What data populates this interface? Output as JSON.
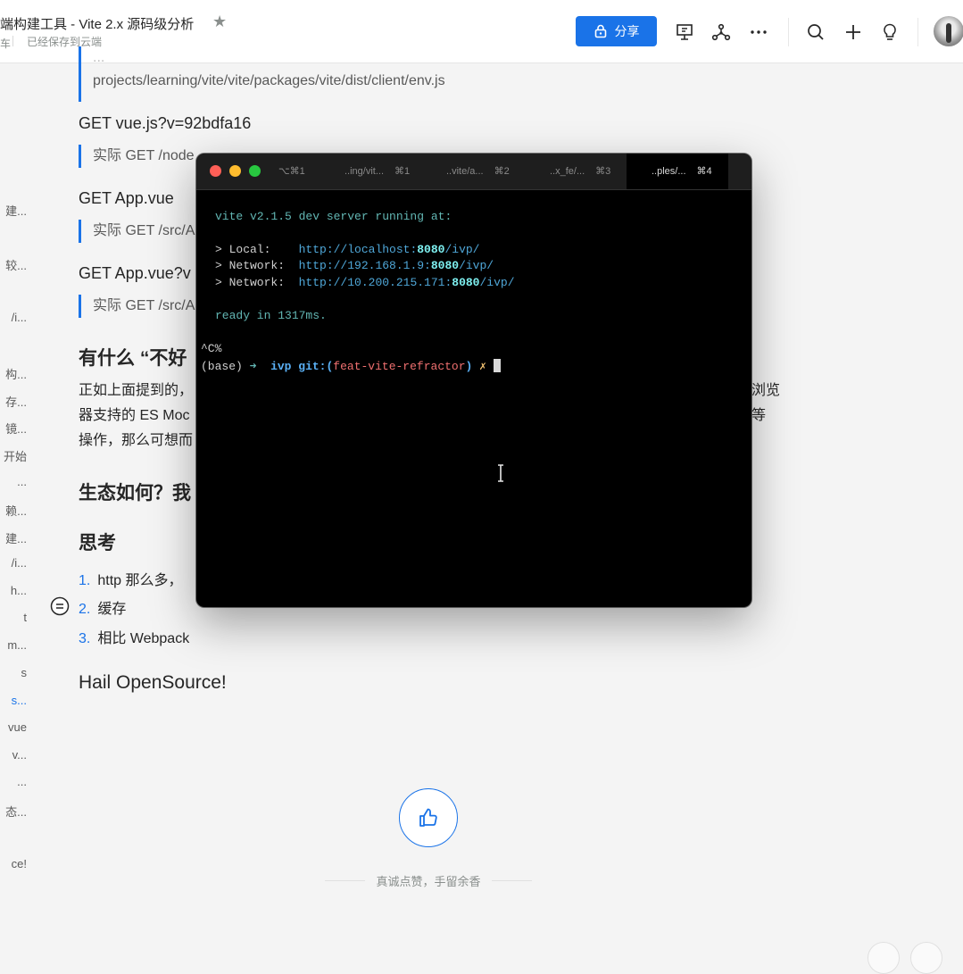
{
  "header": {
    "doc_title": "端构建工具 - Vite 2.x 源码级分析",
    "sub_prefix": "车",
    "save_status": "已经保存到云端",
    "share_label": "分享"
  },
  "sidebar": {
    "items": [
      {
        "label": "建..."
      },
      {
        "label": "较..."
      },
      {
        "label": "/i..."
      },
      {
        "label": "构..."
      },
      {
        "label": "存..."
      },
      {
        "label": "镜..."
      },
      {
        "label": "开始"
      },
      {
        "label": "..."
      },
      {
        "label": "赖..."
      },
      {
        "label": "建..."
      },
      {
        "label": "/i..."
      },
      {
        "label": "h..."
      },
      {
        "label": "t"
      },
      {
        "label": "m..."
      },
      {
        "label": "s"
      },
      {
        "label": "s...",
        "active": true
      },
      {
        "label": "vue"
      },
      {
        "label": "v..."
      },
      {
        "label": "..."
      },
      {
        "label": "态..."
      },
      {
        "label": "ce!"
      }
    ]
  },
  "article": {
    "quote_top_line1": "...",
    "quote_top_line2": "projects/learning/vite/vite/packages/vite/dist/client/env.js",
    "get_vue_js": "GET vue.js?v=92bdfa16",
    "quote_vue_js": "实际 GET /node",
    "get_app_vue": "GET App.vue",
    "quote_app_vue": "实际 GET /src/A",
    "get_app_vue_q": "GET App.vue?v",
    "quote_app_vue_q": "实际 GET /src/A",
    "h_bad": "有什么 “不好",
    "para_line1": "正如上面提到的，",
    "para_line1_right": "浏览",
    "para_line2": "器支持的 ES Moc",
    "para_line2_right": "等",
    "para_line3": "操作，那么可想而",
    "h_eco": "生态如何？我",
    "h_think": "思考",
    "ol": [
      {
        "num": "1.",
        "text": "http 那么多，"
      },
      {
        "num": "2.",
        "text": "缓存"
      },
      {
        "num": "3.",
        "text": "相比 Webpack"
      }
    ],
    "h_hail": "Hail OpenSource!",
    "like_caption": "真诚点赞，手留余香"
  },
  "terminal": {
    "tabs": [
      {
        "label": "⌥⌘1",
        "kbd": ""
      },
      {
        "label": "..ing/vit...",
        "kbd": "⌘1"
      },
      {
        "label": "..vite/a...",
        "kbd": "⌘2"
      },
      {
        "label": "..x_fe/...",
        "kbd": "⌘3"
      },
      {
        "label": "..ples/...",
        "kbd": "⌘4",
        "active": true
      }
    ],
    "line_server": "vite v2.1.5 dev server running at:",
    "local_label": "> Local:    ",
    "local_url_a": "http://localhost:",
    "local_port": "8080",
    "local_url_b": "/ivp/",
    "net1_label": "> Network:  ",
    "net1_url_a": "http://192.168.1.9:",
    "net1_port": "8080",
    "net1_url_b": "/ivp/",
    "net2_label": "> Network:  ",
    "net2_url_a": "http://10.200.215.171:",
    "net2_port": "8080",
    "net2_url_b": "/ivp/",
    "ready": "ready in 1317ms.",
    "ctrl_c": "^C%",
    "prompt_env": "(base)",
    "prompt_arrow": "➜",
    "prompt_dir": "ivp",
    "prompt_git": "git:(",
    "prompt_branch": "feat-vite-refractor",
    "prompt_git_end": ")",
    "prompt_dirty": "✗"
  },
  "colors": {
    "accent": "#1a73e8",
    "terminal_bg": "#000000",
    "terminal_green": "#62b6b3",
    "terminal_branch": "#f07070"
  }
}
